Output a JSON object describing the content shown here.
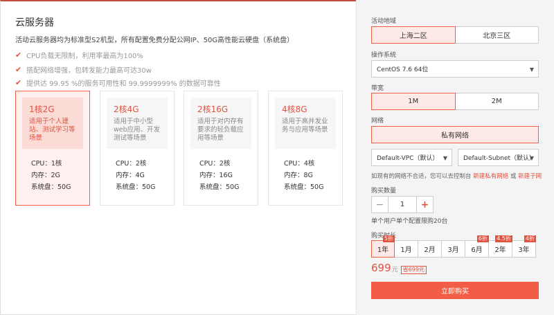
{
  "title": "云服务器",
  "description": "活动云服务器均为标准型S2机型，所有配置免费分配公网IP、50G高性能云硬盘（系统盘）",
  "features": [
    "CPU负载无限制，利用率最高为100%",
    "搭配网络增强，包转发能力最高可达30w",
    "提供达 99.95 %的服务可用性和 99.9999999% 的数据可靠性"
  ],
  "plans": [
    {
      "name": "1核2G",
      "desc": "适用于个人建站、测试学习等场景",
      "cpu": "CPU：1核",
      "mem": "内存：2G",
      "disk": "系统盘：50G"
    },
    {
      "name": "2核4G",
      "desc": "适用于中小型web应用、开发测试等场景",
      "cpu": "CPU：2核",
      "mem": "内存：4G",
      "disk": "系统盘：50G"
    },
    {
      "name": "2核16G",
      "desc": "适用于对内存有要求的轻负载应用等场景",
      "cpu": "CPU：2核",
      "mem": "内存：16G",
      "disk": "系统盘：50G"
    },
    {
      "name": "4核8G",
      "desc": "适用于高并发业务与应用等场景",
      "cpu": "CPU：4核",
      "mem": "内存：8G",
      "disk": "系统盘：50G"
    }
  ],
  "config": {
    "region_label": "活动地域",
    "regions": [
      "上海二区",
      "北京三区"
    ],
    "os_label": "操作系统",
    "os_value": "CentOS 7.6 64位",
    "bandwidth_label": "带宽",
    "bandwidths": [
      "1M",
      "2M"
    ],
    "network_label": "网络",
    "network_value": "私有网络",
    "vpc_value": "Default-VPC（默认）",
    "subnet_value": "Default-Subnet（默认）",
    "note_text": "如现有的网络不合适，您可以去控制台",
    "note_link1": "新建私有网络",
    "note_or": "或",
    "note_link2": "新建子网",
    "qty_label": "购买数量",
    "qty_value": "1",
    "qty_minus": "−",
    "qty_plus": "+",
    "limit_note": "单个用户单个配置限购20台",
    "duration_label": "购买时长",
    "durations": [
      {
        "label": "1年",
        "badge": "5折"
      },
      {
        "label": "1月",
        "badge": ""
      },
      {
        "label": "2月",
        "badge": ""
      },
      {
        "label": "3月",
        "badge": ""
      },
      {
        "label": "6月",
        "badge": "6折"
      },
      {
        "label": "2年",
        "badge": "4.5折"
      },
      {
        "label": "3年",
        "badge": "4折"
      }
    ],
    "price_amount": "699",
    "price_unit": "元",
    "price_save": "省699元",
    "buy_label": "立即购买"
  },
  "colors": {
    "accent": "#f15e45",
    "accent_text": "#e2523f",
    "panel_bg": "#f4f4f4"
  }
}
